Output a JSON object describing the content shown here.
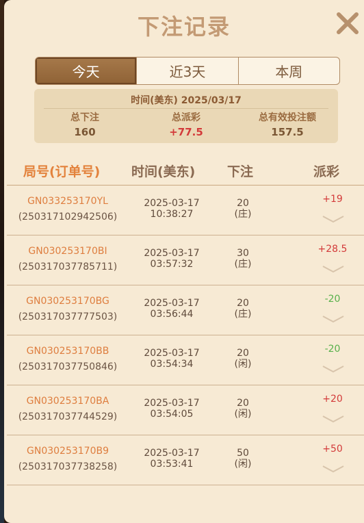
{
  "dialog": {
    "title": "下注记录"
  },
  "tabs": [
    {
      "label": "今天",
      "active": true
    },
    {
      "label": "近3天",
      "active": false
    },
    {
      "label": "本周",
      "active": false
    }
  ],
  "summary": {
    "time_label": "时间(美东)",
    "date": "2025/03/17",
    "total_bet_label": "总下注",
    "total_bet": "160",
    "total_payout_label": "总派彩",
    "total_payout": "+77.5",
    "total_valid_label": "总有效投注额",
    "total_valid": "157.5"
  },
  "columns": [
    "局号(订单号)",
    "时间(美东)",
    "下注",
    "派彩"
  ],
  "rows": [
    {
      "game_id": "GN033253170YL",
      "order_no": "(250317102942506)",
      "date": "2025-03-17",
      "time": "10:38:27",
      "bet": "20",
      "side": "(庄)",
      "payout": "+19"
    },
    {
      "game_id": "GN030253170BI",
      "order_no": "(250317037785711)",
      "date": "2025-03-17",
      "time": "03:57:32",
      "bet": "30",
      "side": "(庄)",
      "payout": "+28.5"
    },
    {
      "game_id": "GN030253170BG",
      "order_no": "(250317037777503)",
      "date": "2025-03-17",
      "time": "03:56:44",
      "bet": "20",
      "side": "(庄)",
      "payout": "-20"
    },
    {
      "game_id": "GN030253170BB",
      "order_no": "(250317037750846)",
      "date": "2025-03-17",
      "time": "03:54:34",
      "bet": "20",
      "side": "(闲)",
      "payout": "-20"
    },
    {
      "game_id": "GN030253170BA",
      "order_no": "(250317037744529)",
      "date": "2025-03-17",
      "time": "03:54:05",
      "bet": "20",
      "side": "(闲)",
      "payout": "+20"
    },
    {
      "game_id": "GN030253170B9",
      "order_no": "(250317037738258)",
      "date": "2025-03-17",
      "time": "03:53:41",
      "bet": "50",
      "side": "(闲)",
      "payout": "+50"
    }
  ],
  "colors": {
    "positive": "#d33a3a",
    "negative": "#58b14b",
    "accent": "#de7d3e"
  },
  "icons": {
    "close": "close-icon",
    "expand": "chevron-down-icon"
  }
}
